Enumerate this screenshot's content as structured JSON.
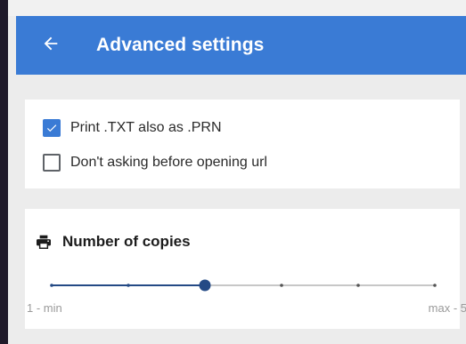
{
  "appbar": {
    "title": "Advanced settings",
    "back_icon": "arrow-left-icon",
    "color": "#3a7bd5"
  },
  "options": [
    {
      "label": "Print .TXT also as .PRN",
      "checked": true
    },
    {
      "label": "Don't asking before opening url",
      "checked": false
    }
  ],
  "copies": {
    "icon": "printer-icon",
    "title": "Number of copies",
    "min_label": "1 - min",
    "max_label": "max - 5",
    "min": 1,
    "max": 5,
    "steps": 6,
    "value_index": 2,
    "accent": "#244a85"
  }
}
